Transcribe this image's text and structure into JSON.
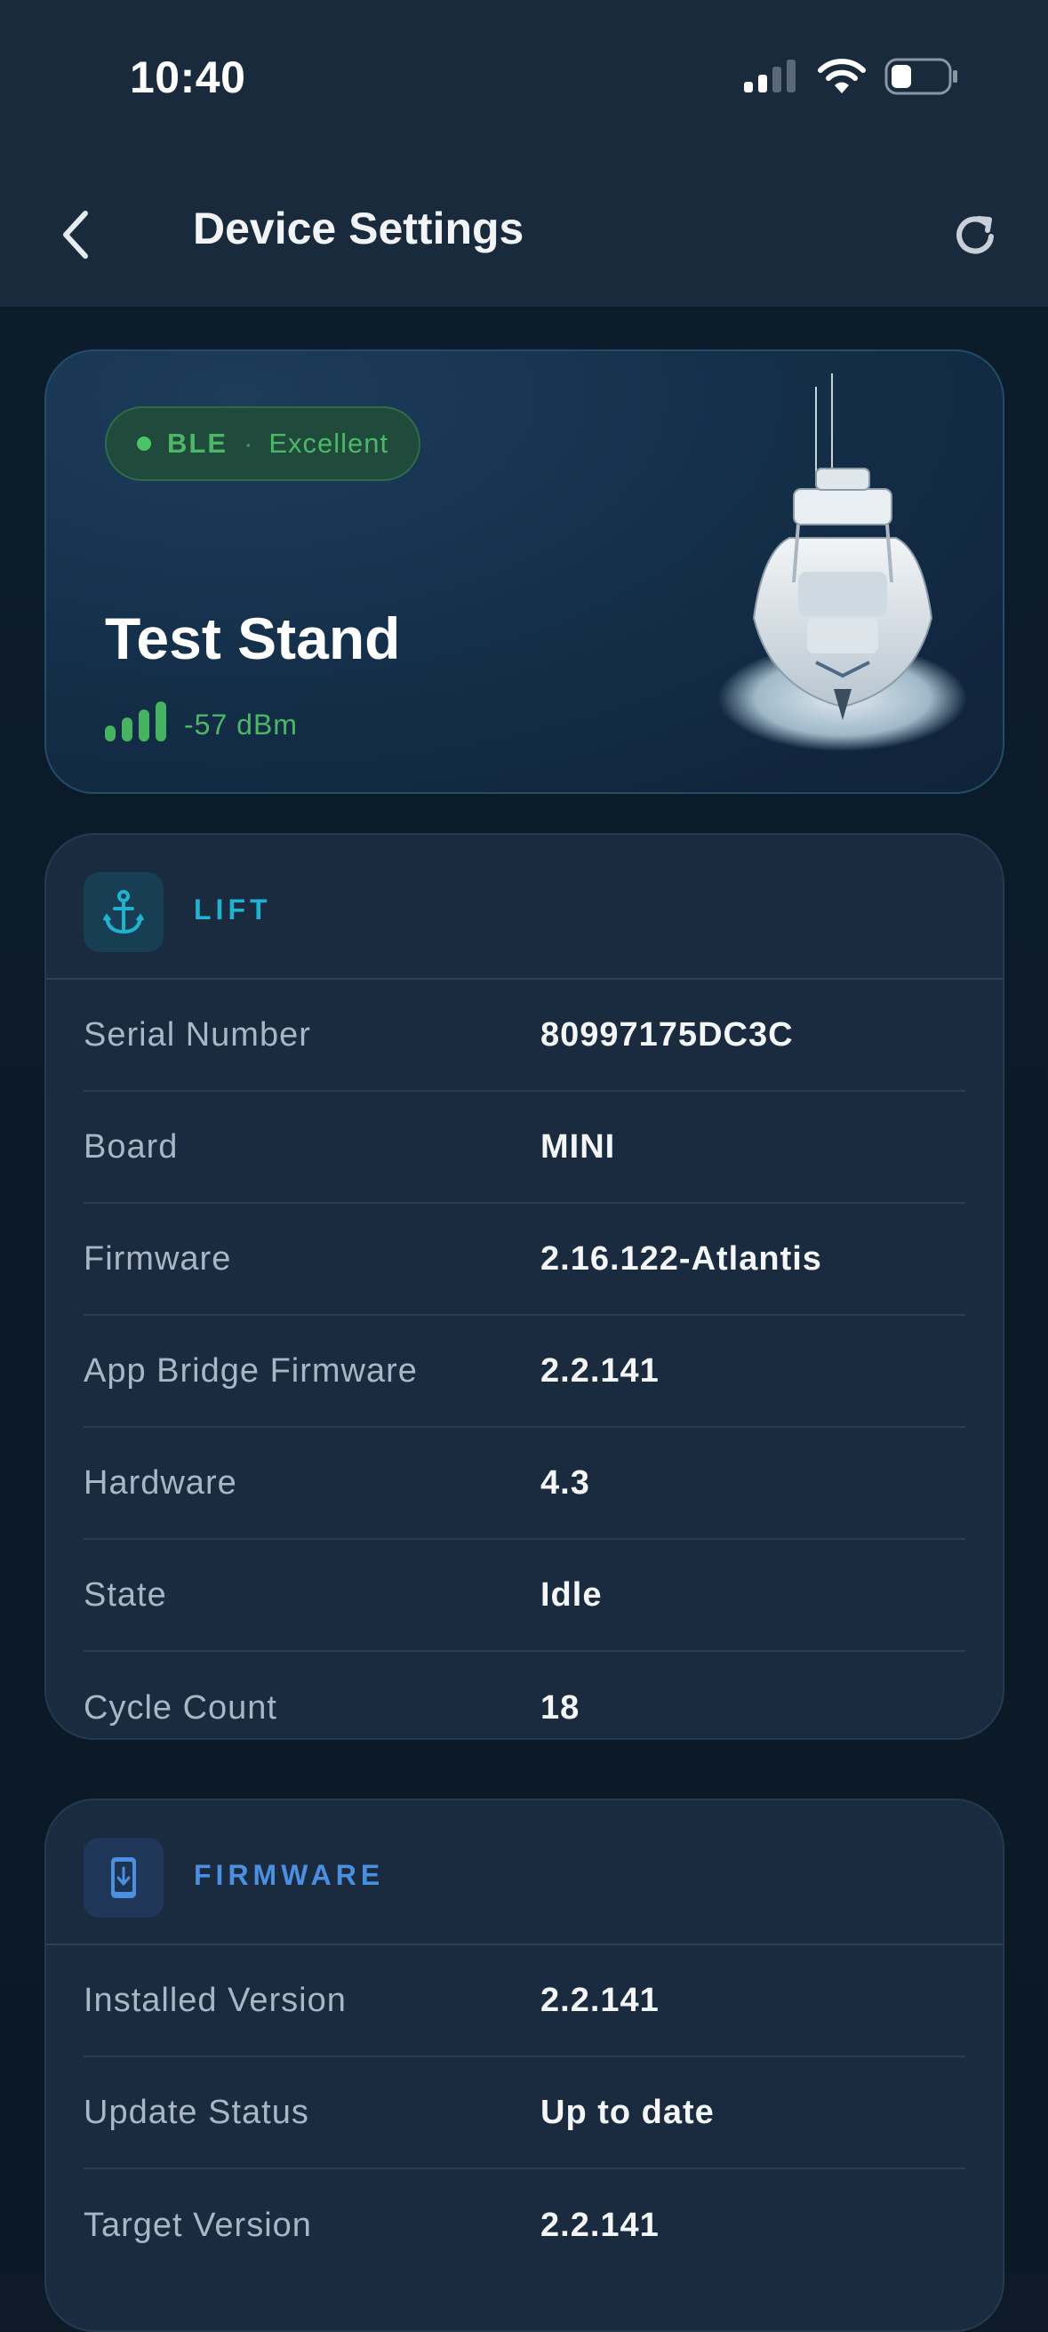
{
  "status_bar": {
    "time": "10:40"
  },
  "nav": {
    "title": "Device Settings"
  },
  "hero": {
    "connection": "BLE",
    "separator": "·",
    "quality": "Excellent",
    "device_name": "Test Stand",
    "signal": "-57 dBm",
    "signal_bars": 4
  },
  "lift": {
    "title": "LIFT",
    "rows": [
      {
        "label": "Serial Number",
        "value": "80997175DC3C"
      },
      {
        "label": "Board",
        "value": "MINI"
      },
      {
        "label": "Firmware",
        "value": "2.16.122-Atlantis"
      },
      {
        "label": "App Bridge Firmware",
        "value": "2.2.141"
      },
      {
        "label": "Hardware",
        "value": "4.3"
      },
      {
        "label": "State",
        "value": "Idle"
      },
      {
        "label": "Cycle Count",
        "value": "18"
      }
    ]
  },
  "firmware": {
    "title": "FIRMWARE",
    "rows": [
      {
        "label": "Installed Version",
        "value": "2.2.141"
      },
      {
        "label": "Update Status",
        "value": "Up to date"
      },
      {
        "label": "Target Version",
        "value": "2.2.141"
      }
    ]
  },
  "colors": {
    "accent_teal": "#1fb3d1",
    "accent_blue": "#4a8fe0",
    "signal_green": "#4cb866"
  },
  "icons": {
    "lift": "anchor-icon",
    "firmware": "phone-download-icon",
    "back": "chevron-left-icon",
    "refresh": "refresh-icon"
  }
}
